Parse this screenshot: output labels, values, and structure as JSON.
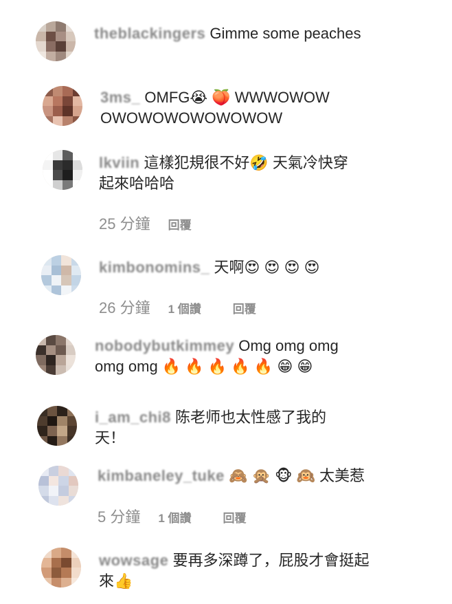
{
  "comments": [
    {
      "username": "theblackingers",
      "text": "Gimme some peaches",
      "avatar_colors": [
        "#d8cfc6",
        "#b9a79a",
        "#8f7b70",
        "#e6ddd6",
        "#c9b6a8",
        "#6d4f45",
        "#a88f84",
        "#d7c8bc",
        "#e4d8cf",
        "#8a6d63",
        "#5a4038",
        "#cbb7aa",
        "#efe7e0",
        "#c2aea2",
        "#a08a7f",
        "#e2d6cc"
      ]
    },
    {
      "username": "3ms_",
      "text": "OMFG😭 🍑 WWWOWOWOWOWOWOWOWOWOW",
      "avatar_colors": [
        "#8d5b4a",
        "#c08a72",
        "#a86a55",
        "#6d3e32",
        "#d9a890",
        "#b87760",
        "#7a4638",
        "#e3b8a3",
        "#c99480",
        "#9b5e4c",
        "#5e3328",
        "#d6a48d",
        "#a77462",
        "#e8c2b0",
        "#b8826c",
        "#8b5644"
      ]
    },
    {
      "username": "lkviin",
      "text": "這樣犯規很不好🤣 天氣冷快穿起來哈哈哈",
      "time": "25 分鐘",
      "reply": "回覆",
      "avatar_colors": [
        "#ffffff",
        "#e6e6e6",
        "#5d5d5d",
        "#ffffff",
        "#f4f4f4",
        "#3a3a3a",
        "#2b2b2b",
        "#dcdcdc",
        "#ffffff",
        "#4b4b4b",
        "#1e1e1e",
        "#f0f0f0",
        "#ffffff",
        "#cfcfcf",
        "#7a7a7a",
        "#ffffff"
      ]
    },
    {
      "username": "kimbonomins_",
      "text": "天啊😍 😍 😍 😍",
      "time": "26 分鐘",
      "likes": "1 個讚",
      "reply": "回覆",
      "avatar_colors": [
        "#dde7f0",
        "#bcd0e3",
        "#f1e4da",
        "#c9d9e8",
        "#e9eef4",
        "#a8bfd6",
        "#cfb8a8",
        "#dfe9f2",
        "#b4c9dd",
        "#eff3f7",
        "#d6c6b8",
        "#c3d5e6",
        "#e3ecf4",
        "#aec4da",
        "#f2f5f8",
        "#cddceb"
      ]
    },
    {
      "username": "nobodybutkimmey",
      "text": "Omg omg omg omg omg 🔥 🔥 🔥 🔥 🔥 😁 😁",
      "avatar_colors": [
        "#c9b8ad",
        "#5a4a42",
        "#8b766a",
        "#e2d6cd",
        "#3b302b",
        "#a58f82",
        "#6d5a50",
        "#d8ccc3",
        "#7f6b60",
        "#2e2521",
        "#b9a598",
        "#ece2da",
        "#9a8477",
        "#4a3c35",
        "#cbbcb1",
        "#e9e0d9"
      ]
    },
    {
      "username": "i_am_chi8",
      "text": "陈老师也太性感了我的天！",
      "avatar_colors": [
        "#3a2e24",
        "#6b5340",
        "#2b211a",
        "#8c7058",
        "#4e3c2e",
        "#1f1712",
        "#a08468",
        "#5c4634",
        "#2f241c",
        "#7d6350",
        "#c2a688",
        "#463528",
        "#6e5645",
        "#241b15",
        "#93775f",
        "#3d2f25"
      ]
    },
    {
      "username": "kimbaneley_tuke",
      "text": "🙈 🙊 🐵 🙉  太美惹",
      "time": "5 分鐘",
      "likes": "1 個讚",
      "reply": "回覆",
      "avatar_colors": [
        "#e7eaf3",
        "#c9cfe0",
        "#ead9d4",
        "#dfe4ef",
        "#b8c1d8",
        "#f3e6e0",
        "#cdd5e6",
        "#e2c8bf",
        "#d4dbe9",
        "#f1f3f8",
        "#c4ccdf",
        "#e9dcd6",
        "#bfc8dc",
        "#dde2ee",
        "#efe3dd",
        "#d0d7e7"
      ]
    },
    {
      "username": "wowsage",
      "text": "要再多深蹲了，屁股才會挺起來👍",
      "avatar_colors": [
        "#f0d9c8",
        "#d9a987",
        "#c48d6a",
        "#f5e4d7",
        "#e3b696",
        "#a86f4c",
        "#7a4a30",
        "#ecd0bb",
        "#d29b78",
        "#8d5b3c",
        "#b57a55",
        "#f2dccb",
        "#e8c4a8",
        "#c68e6b",
        "#ddb090",
        "#f7e8dc"
      ]
    }
  ]
}
